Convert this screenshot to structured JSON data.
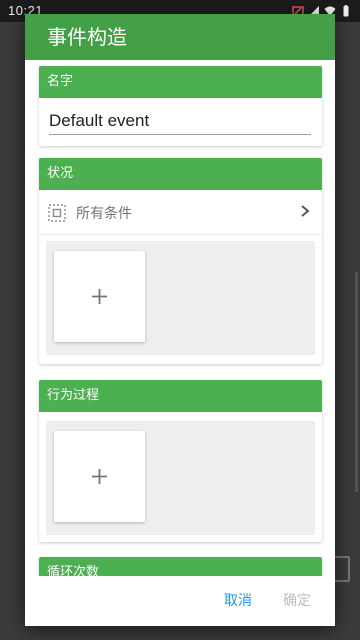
{
  "status_bar": {
    "time": "10:21",
    "icons": [
      "battery-saver-icon",
      "signal-icon",
      "wifi-icon",
      "battery-icon"
    ]
  },
  "dialog": {
    "title": "事件构造",
    "name_section": {
      "header": "名字",
      "input_value": "Default event"
    },
    "condition_section": {
      "header": "状况",
      "row_label": "所有条件",
      "row_icon": "select-all-icon",
      "add_icon": "plus-icon"
    },
    "action_section": {
      "header": "行为过程",
      "add_icon": "plus-icon"
    },
    "loop_section": {
      "header": "循环次数"
    },
    "buttons": {
      "cancel": "取消",
      "ok": "确定"
    }
  },
  "colors": {
    "accent_green": "#43a047",
    "header_green": "#4caf50",
    "cancel_blue": "#2196f3",
    "disabled_grey": "#bdbdbd"
  }
}
